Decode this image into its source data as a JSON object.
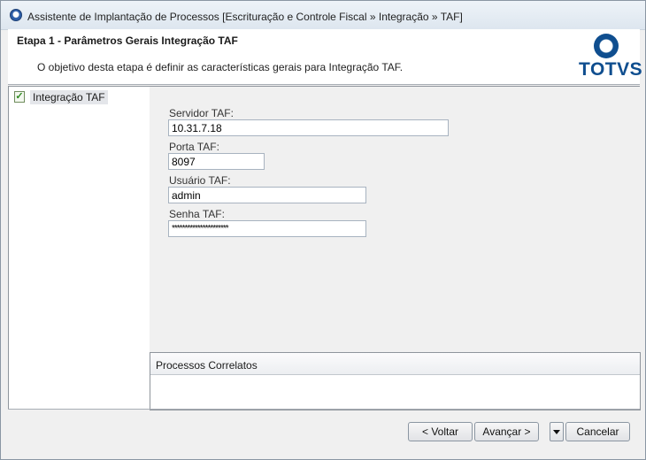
{
  "window": {
    "title": "Assistente de Implantação de Processos [Escrituração e Controle Fiscal » Integração » TAF]"
  },
  "header": {
    "step_title": "Etapa 1 - Parâmetros Gerais Integração TAF",
    "description": "O objetivo desta etapa é definir as características gerais para Integração TAF.",
    "logo_text": "TOTVS"
  },
  "tree": {
    "items": [
      {
        "label": "Integração TAF",
        "icon": "checklist-icon"
      }
    ]
  },
  "form": {
    "servidor": {
      "label": "Servidor TAF:",
      "value": "10.31.7.18"
    },
    "porta": {
      "label": "Porta TAF:",
      "value": "8097"
    },
    "usuario": {
      "label": "Usuário TAF:",
      "value": "admin"
    },
    "senha": {
      "label": "Senha TAF:",
      "value": "**********************"
    }
  },
  "correlatos": {
    "title": "Processos Correlatos"
  },
  "buttons": {
    "voltar": "< Voltar",
    "avancar": "Avançar >",
    "cancelar": "Cancelar"
  },
  "colors": {
    "brand": "#0f4e8f",
    "window_bg": "#f0f0f0"
  }
}
